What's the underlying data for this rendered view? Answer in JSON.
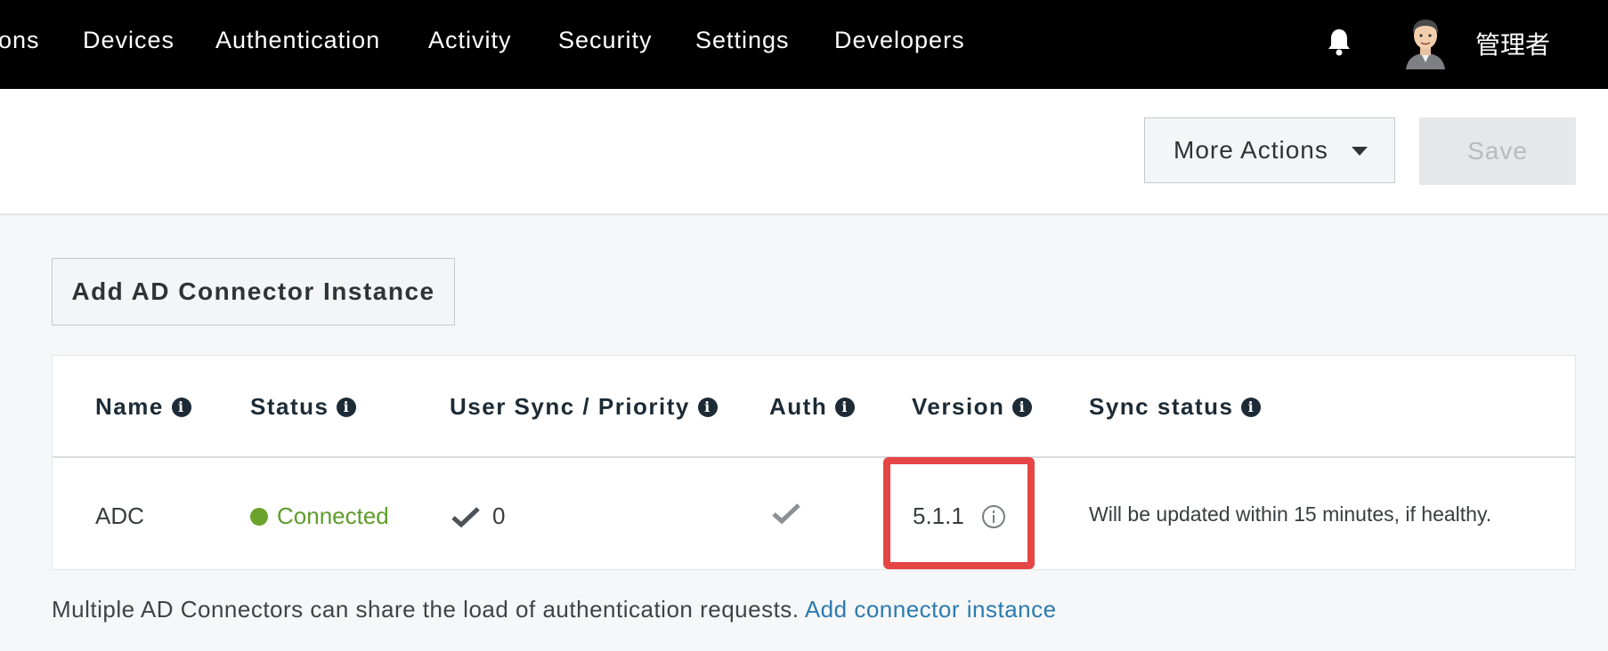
{
  "nav": {
    "items": [
      "ons",
      "Devices",
      "Authentication",
      "Activity",
      "Security",
      "Settings",
      "Developers"
    ],
    "username": "管理者",
    "icons": {
      "bell": "bell-icon",
      "avatar": "avatar"
    }
  },
  "header": {
    "more_actions_label": "More Actions",
    "save_label": "Save"
  },
  "add_button_label": "Add AD Connector Instance",
  "table": {
    "columns": [
      "Name",
      "Status",
      "User Sync / Priority",
      "Auth",
      "Version",
      "Sync status"
    ],
    "rows": [
      {
        "name": "ADC",
        "status": "Connected",
        "user_sync_priority": "0",
        "auth": "check-icon",
        "version": "5.1.1",
        "sync_status": "Will be updated within 15 minutes, if healthy."
      }
    ]
  },
  "footer": {
    "note": "Multiple AD Connectors can share the load of authentication requests.",
    "link": "Add connector instance"
  },
  "colors": {
    "nav_bg": "#000000",
    "status_green": "#5e9d2a",
    "highlight_red": "#e64545",
    "link_blue": "#2b7bb0"
  }
}
